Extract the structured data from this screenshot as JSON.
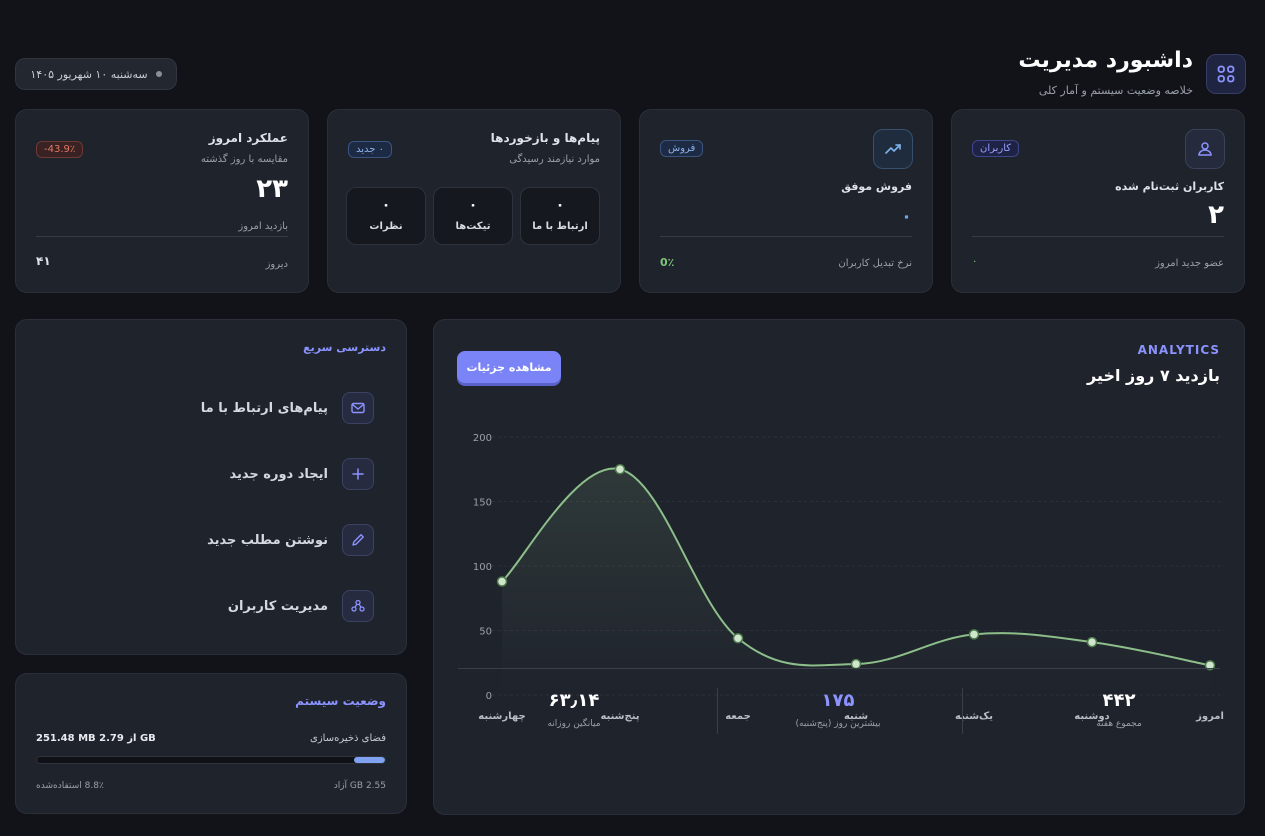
{
  "header": {
    "title": "داشبورد مدیریت",
    "subtitle": "خلاصه وضعیت سیستم و آمار کلی",
    "date": "سه‌شنبه ۱۰ شهریور ۱۴۰۵",
    "icon": "grid-icon"
  },
  "cards": {
    "users": {
      "badge": "کاربران",
      "label": "کاربران ثبت‌نام شده",
      "value": "۲",
      "footer_label": "عضو جدید امروز",
      "footer_value": "۰",
      "icon": "users-icon"
    },
    "sales": {
      "badge": "فروش",
      "label": "فروش موفق",
      "value": "۰",
      "footer_label": "نرخ تبدیل کاربران",
      "footer_value": "0٪",
      "icon": "trend-up-icon"
    },
    "messages": {
      "title": "پیام‌ها و بازخوردها",
      "subtitle": "موارد نیازمند رسیدگی",
      "badge": "۰ جدید",
      "boxes": [
        {
          "label": "ارتباط با ما",
          "value": "۰"
        },
        {
          "label": "تیکت‌ها",
          "value": "۰"
        },
        {
          "label": "نظرات",
          "value": "۰"
        }
      ]
    },
    "performance": {
      "title": "عملکرد امروز",
      "subtitle": "مقایسه با روز گذشته",
      "badge": "-43.9٪",
      "value": "۲۳",
      "value_label": "بازدید امروز",
      "footer_label": "دیروز",
      "footer_value": "۴۱"
    }
  },
  "quick_access": {
    "title": "دسترسی سریع",
    "items": [
      {
        "label": "پیام‌های ارتباط با ما",
        "icon": "mail-icon"
      },
      {
        "label": "ایجاد دوره جدید",
        "icon": "plus-icon"
      },
      {
        "label": "نوشتن مطلب جدید",
        "icon": "pen-icon"
      },
      {
        "label": "مدیریت کاربران",
        "icon": "users-icon"
      }
    ]
  },
  "system": {
    "title": "وضعیت سیستم",
    "storage_label": "فضای ذخیره‌سازی",
    "storage_value": "251.48 MB از 2.79 GB",
    "progress": 0.088,
    "free": "2.55 GB آزاد",
    "used": "8.8٪ استفاده‌شده"
  },
  "analytics": {
    "eyebrow": "ANALYTICS",
    "title": "بازدید ۷ روز اخیر",
    "details_button": "مشاهده جزئیات",
    "summary": [
      {
        "label": "مجموع هفته",
        "value": "۴۴۲"
      },
      {
        "label": "بیشترین روز (پنج‌شنبه)",
        "value": "۱۷۵"
      },
      {
        "label": "میانگین روزانه",
        "value": "۶۳٫۱۴"
      }
    ]
  },
  "colors": {
    "accent": "#7b84f7",
    "line": "#8dbf8a",
    "danger": "#e07a5f",
    "success": "#7fc77a"
  },
  "chart_data": {
    "type": "line",
    "categories": [
      "چهارشنبه",
      "پنج‌شنبه",
      "جمعه",
      "شنبه",
      "یک‌شنبه",
      "دوشنبه",
      "امروز"
    ],
    "values": [
      88,
      175,
      44,
      24,
      47,
      41,
      23
    ],
    "ylim": [
      0,
      200
    ],
    "yticks": [
      0,
      50,
      100,
      150,
      200
    ],
    "grid": true,
    "legend": "none"
  }
}
